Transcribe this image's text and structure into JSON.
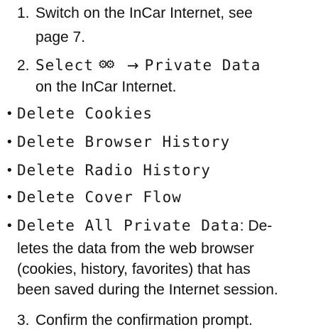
{
  "steps": {
    "step1_num": "1.",
    "step1_line1": "Switch on the InCar Internet, see",
    "step1_line2": "page 7.",
    "step2_num": "2.",
    "step2_select": "Select",
    "step2_arrow": "→",
    "step2_target": "Private Data",
    "step2_line2": "on the InCar Internet.",
    "step3_num": "3.",
    "step3_text": "Confirm the confirmation prompt."
  },
  "options": [
    {
      "label": "Delete Cookies"
    },
    {
      "label": "Delete Browser History"
    },
    {
      "label": "Delete Radio History"
    },
    {
      "label": "Delete Cover Flow"
    },
    {
      "label": "Delete All Private Data",
      "desc_line1_suffix": ": De-",
      "desc_line2": "letes the data from the web browser",
      "desc_line3": "(cookies, history, favorites) that has",
      "desc_line4": "been saved during the Internet session."
    }
  ],
  "icons": {
    "settings": "gear-icon"
  }
}
